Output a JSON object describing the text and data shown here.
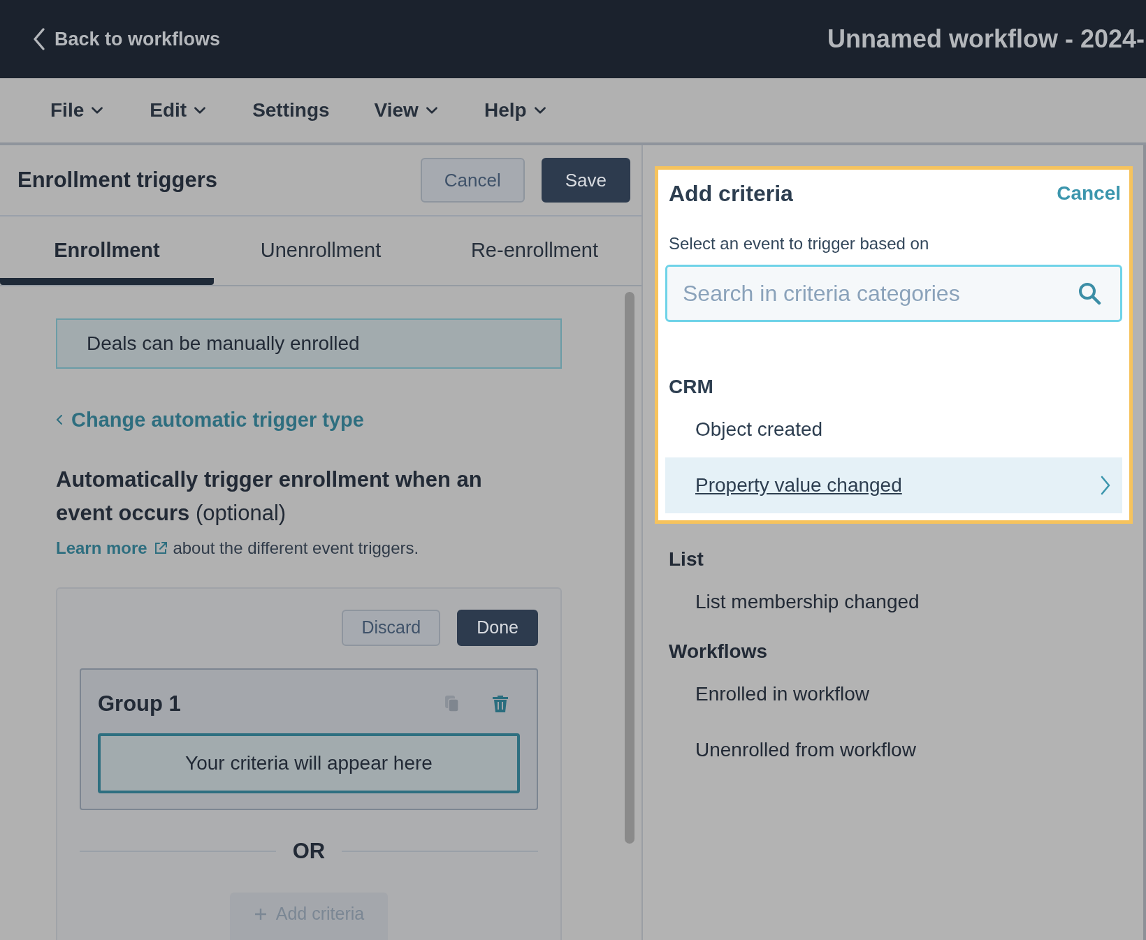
{
  "top_bar": {
    "back_link": "Back to workflows",
    "title": "Unnamed workflow - 2024-"
  },
  "menu": [
    {
      "label": "File",
      "dropdown": true
    },
    {
      "label": "Edit",
      "dropdown": true
    },
    {
      "label": "Settings",
      "dropdown": false
    },
    {
      "label": "View",
      "dropdown": true
    },
    {
      "label": "Help",
      "dropdown": true
    }
  ],
  "panel": {
    "title": "Enrollment triggers",
    "buttons": [
      {
        "label": "Cancel",
        "kind": "secondary"
      },
      {
        "label": "Save",
        "kind": "primary"
      }
    ],
    "tabs": [
      {
        "label": "Enrollment",
        "selected": true
      },
      {
        "label": "Unenrollment",
        "selected": false
      },
      {
        "label": "Re-enrollment",
        "selected": false
      }
    ],
    "notice": "Deals can be manually enrolled",
    "back_link": "Change automatic trigger type",
    "heading": "**Automatically trigger enrollment when an event occurs** (optional)",
    "learn_more": {
      "link": "Learn more",
      "text": "about the different event triggers."
    },
    "editor": {
      "buttons": [
        {
          "label": "Discard",
          "kind": "secondary"
        },
        {
          "label": "Done",
          "kind": "primary"
        }
      ],
      "group": {
        "title": "Group 1",
        "criteria_text": "Your criteria will appear here"
      },
      "separator": "OR",
      "add_button": "Add criteria"
    }
  },
  "criteria_panel": {
    "title": "Add criteria",
    "cancel": "Cancel",
    "subtitle": "Select an event to trigger based on",
    "search": {
      "placeholder": "Search in criteria categories"
    },
    "categories": [
      {
        "name": "CRM",
        "highlighted": true,
        "items": [
          {
            "label": "Object created",
            "selected": false
          },
          {
            "label": "Property value changed",
            "selected": true
          }
        ]
      },
      {
        "name": "List",
        "highlighted": false,
        "items": [
          {
            "label": "List membership changed",
            "selected": false
          }
        ]
      },
      {
        "name": "Workflows",
        "highlighted": false,
        "items": [
          {
            "label": "Enrolled in workflow",
            "selected": false
          },
          {
            "label": "Unenrolled from workflow",
            "selected": false
          }
        ]
      }
    ]
  }
}
